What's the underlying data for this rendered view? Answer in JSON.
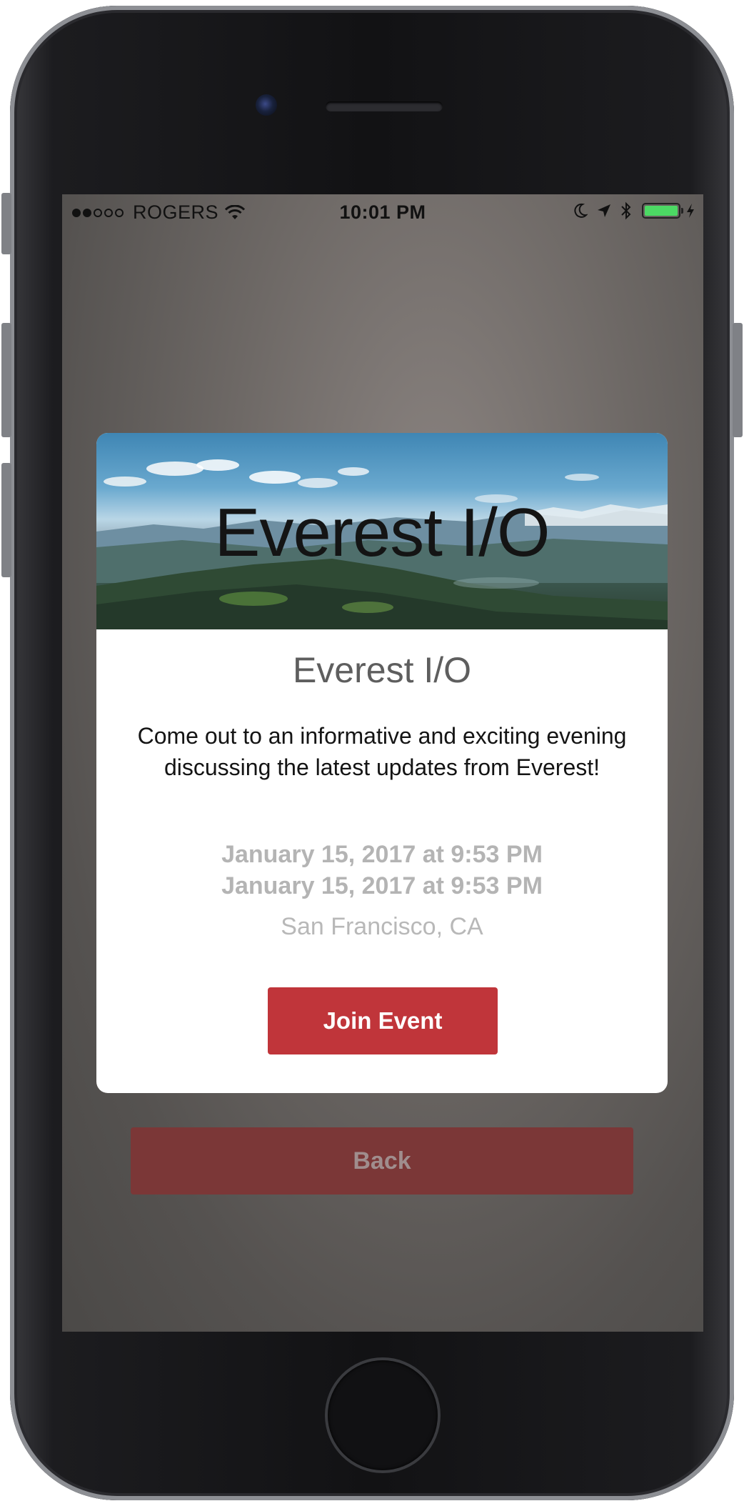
{
  "status_bar": {
    "signal": {
      "filled": 2,
      "total": 5
    },
    "carrier": "ROGERS",
    "time": "10:01 PM",
    "icons": [
      "wifi-icon",
      "moon-icon",
      "location-arrow-icon",
      "bluetooth-icon",
      "battery-icon",
      "charging-bolt-icon"
    ],
    "battery_level": 1.0,
    "battery_color": "#4cd964"
  },
  "event": {
    "banner_title": "Everest I/O",
    "title": "Everest I/O",
    "description": "Come out to an informative and exciting evening discussing the latest updates from Everest!",
    "start_date": "January 15, 2017 at 9:53 PM",
    "end_date": "January 15, 2017 at 9:53 PM",
    "location": "San Francisco, CA",
    "join_label": "Join Event"
  },
  "back_label": "Back",
  "colors": {
    "accent": "#c0353a",
    "back_button": "#7b3737"
  }
}
